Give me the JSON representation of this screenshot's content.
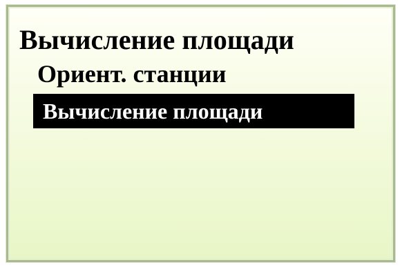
{
  "screen": {
    "title": "Вычисление площади",
    "menu": {
      "items": [
        {
          "label": "Ориент. станции",
          "selected": false
        },
        {
          "label": "Вычисление площади",
          "selected": true
        }
      ]
    }
  },
  "colors": {
    "frame_border": "#a9b98f",
    "background_top": "#fffff7",
    "background_bottom": "#e8f6c6",
    "highlight_background": "#000000",
    "highlight_text": "#ffffff",
    "text": "#000000"
  }
}
